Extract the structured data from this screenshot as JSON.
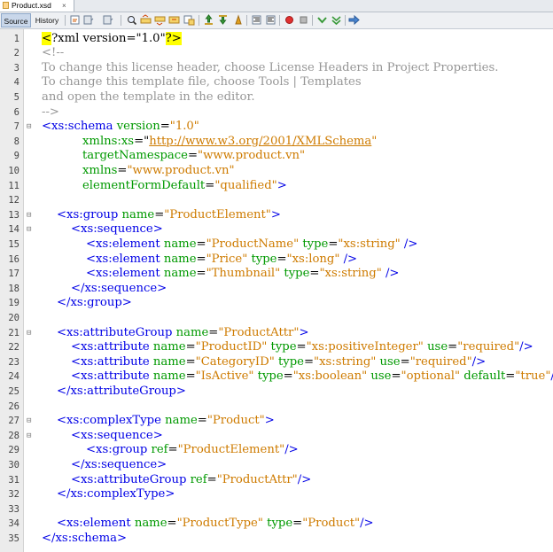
{
  "file_tab": {
    "name": "Product.xsd",
    "close": "×"
  },
  "toolbar": {
    "source_label": "Source",
    "history_label": "History",
    "icons": [
      "last-edit-icon",
      "back-icon",
      "forward-icon",
      "find-icon",
      "find-prev-icon",
      "find-next-icon",
      "toggle-highlight-icon",
      "toggle-rect-select-icon",
      "prev-bookmark-icon",
      "next-bookmark-icon",
      "toggle-bookmark-icon",
      "shift-left-icon",
      "shift-right-icon",
      "start-macro-icon",
      "stop-macro-icon",
      "check-xml-icon",
      "validate-xml-icon",
      "xsl-transform-icon"
    ]
  },
  "lines": [
    {
      "n": "1",
      "fold": "",
      "indent": 0,
      "segs": [
        [
          "pi",
          "<"
        ],
        [
          "pi",
          "?xml "
        ],
        [
          "pi",
          "version=\"1.0\""
        ],
        [
          "pi",
          "?>"
        ]
      ]
    },
    {
      "n": "2",
      "fold": "",
      "indent": 0,
      "segs": [
        [
          "cmt",
          "<!--"
        ]
      ]
    },
    {
      "n": "3",
      "fold": "",
      "indent": 0,
      "segs": [
        [
          "cmt",
          "To change this license header, choose License Headers in Project Properties."
        ]
      ]
    },
    {
      "n": "4",
      "fold": "",
      "indent": 0,
      "segs": [
        [
          "cmt",
          "To change this template file, choose Tools | Templates"
        ]
      ]
    },
    {
      "n": "5",
      "fold": "",
      "indent": 0,
      "segs": [
        [
          "cmt",
          "and open the template in the editor."
        ]
      ]
    },
    {
      "n": "6",
      "fold": "",
      "indent": 0,
      "segs": [
        [
          "cmt",
          "-->"
        ]
      ]
    },
    {
      "n": "7",
      "fold": "-",
      "indent": 0,
      "segs": [
        [
          "tag",
          "<xs:schema "
        ],
        [
          "attr",
          "version"
        ],
        [
          "txt",
          "="
        ],
        [
          "val",
          "\"1.0\""
        ]
      ]
    },
    {
      "n": "8",
      "fold": "",
      "indent": 1,
      "segs": [
        [
          "attr",
          "xmlns:xs"
        ],
        [
          "txt",
          "=\""
        ],
        [
          "link",
          "http://www.w3.org/2001/XMLSchema"
        ],
        [
          "val",
          "\""
        ]
      ]
    },
    {
      "n": "9",
      "fold": "",
      "indent": 1,
      "segs": [
        [
          "attr",
          "targetNamespace"
        ],
        [
          "txt",
          "="
        ],
        [
          "val",
          "\"www.product.vn\""
        ]
      ]
    },
    {
      "n": "10",
      "fold": "",
      "indent": 1,
      "segs": [
        [
          "attr",
          "xmlns"
        ],
        [
          "txt",
          "="
        ],
        [
          "val",
          "\"www.product.vn\""
        ]
      ]
    },
    {
      "n": "11",
      "fold": "",
      "indent": 1,
      "segs": [
        [
          "attr",
          "elementFormDefault"
        ],
        [
          "txt",
          "="
        ],
        [
          "val",
          "\"qualified\""
        ],
        [
          "tag",
          ">"
        ]
      ]
    },
    {
      "n": "12",
      "fold": "",
      "indent": 0,
      "segs": []
    },
    {
      "n": "13",
      "fold": "-",
      "indent": 2,
      "segs": [
        [
          "tag",
          "<xs:group "
        ],
        [
          "attr",
          "name"
        ],
        [
          "txt",
          "="
        ],
        [
          "val",
          "\"ProductElement\""
        ],
        [
          "tag",
          ">"
        ]
      ]
    },
    {
      "n": "14",
      "fold": "-",
      "indent": 3,
      "segs": [
        [
          "tag",
          "<xs:sequence>"
        ]
      ]
    },
    {
      "n": "15",
      "fold": "",
      "indent": 4,
      "segs": [
        [
          "tag",
          "<xs:element "
        ],
        [
          "attr",
          "name"
        ],
        [
          "txt",
          "="
        ],
        [
          "val",
          "\"ProductName\""
        ],
        [
          "txt",
          " "
        ],
        [
          "attr",
          "type"
        ],
        [
          "txt",
          "="
        ],
        [
          "val",
          "\"xs:string\""
        ],
        [
          "tag",
          " />"
        ]
      ]
    },
    {
      "n": "16",
      "fold": "",
      "indent": 4,
      "segs": [
        [
          "tag",
          "<xs:element "
        ],
        [
          "attr",
          "name"
        ],
        [
          "txt",
          "="
        ],
        [
          "val",
          "\"Price\""
        ],
        [
          "txt",
          " "
        ],
        [
          "attr",
          "type"
        ],
        [
          "txt",
          "="
        ],
        [
          "val",
          "\"xs:long\""
        ],
        [
          "tag",
          " />"
        ]
      ]
    },
    {
      "n": "17",
      "fold": "",
      "indent": 4,
      "segs": [
        [
          "tag",
          "<xs:element "
        ],
        [
          "attr",
          "name"
        ],
        [
          "txt",
          "="
        ],
        [
          "val",
          "\"Thumbnail\""
        ],
        [
          "txt",
          " "
        ],
        [
          "attr",
          "type"
        ],
        [
          "txt",
          "="
        ],
        [
          "val",
          "\"xs:string\""
        ],
        [
          "tag",
          " />"
        ]
      ]
    },
    {
      "n": "18",
      "fold": "",
      "indent": 3,
      "segs": [
        [
          "tag",
          "</xs:sequence>"
        ]
      ]
    },
    {
      "n": "19",
      "fold": "",
      "indent": 2,
      "segs": [
        [
          "tag",
          "</xs:group>"
        ]
      ]
    },
    {
      "n": "20",
      "fold": "",
      "indent": 0,
      "segs": []
    },
    {
      "n": "21",
      "fold": "-",
      "indent": 2,
      "segs": [
        [
          "tag",
          "<xs:attributeGroup "
        ],
        [
          "attr",
          "name"
        ],
        [
          "txt",
          "="
        ],
        [
          "val",
          "\"ProductAttr\""
        ],
        [
          "tag",
          ">"
        ]
      ]
    },
    {
      "n": "22",
      "fold": "",
      "indent": 3,
      "segs": [
        [
          "tag",
          "<xs:attribute "
        ],
        [
          "attr",
          "name"
        ],
        [
          "txt",
          "="
        ],
        [
          "val",
          "\"ProductID\""
        ],
        [
          "txt",
          " "
        ],
        [
          "attr",
          "type"
        ],
        [
          "txt",
          "="
        ],
        [
          "val",
          "\"xs:positiveInteger\""
        ],
        [
          "txt",
          " "
        ],
        [
          "attr",
          "use"
        ],
        [
          "txt",
          "="
        ],
        [
          "val",
          "\"required\""
        ],
        [
          "tag",
          "/>"
        ]
      ]
    },
    {
      "n": "23",
      "fold": "",
      "indent": 3,
      "segs": [
        [
          "tag",
          "<xs:attribute "
        ],
        [
          "attr",
          "name"
        ],
        [
          "txt",
          "="
        ],
        [
          "val",
          "\"CategoryID\""
        ],
        [
          "txt",
          " "
        ],
        [
          "attr",
          "type"
        ],
        [
          "txt",
          "="
        ],
        [
          "val",
          "\"xs:string\""
        ],
        [
          "txt",
          " "
        ],
        [
          "attr",
          "use"
        ],
        [
          "txt",
          "="
        ],
        [
          "val",
          "\"required\""
        ],
        [
          "tag",
          "/>"
        ]
      ]
    },
    {
      "n": "24",
      "fold": "",
      "indent": 3,
      "segs": [
        [
          "tag",
          "<xs:attribute "
        ],
        [
          "attr",
          "name"
        ],
        [
          "txt",
          "="
        ],
        [
          "val",
          "\"IsActive\""
        ],
        [
          "txt",
          " "
        ],
        [
          "attr",
          "type"
        ],
        [
          "txt",
          "="
        ],
        [
          "val",
          "\"xs:boolean\""
        ],
        [
          "txt",
          " "
        ],
        [
          "attr",
          "use"
        ],
        [
          "txt",
          "="
        ],
        [
          "val",
          "\"optional\""
        ],
        [
          "txt",
          " "
        ],
        [
          "attr",
          "default"
        ],
        [
          "txt",
          "="
        ],
        [
          "val",
          "\"true\""
        ],
        [
          "tag",
          "/>"
        ]
      ]
    },
    {
      "n": "25",
      "fold": "",
      "indent": 2,
      "segs": [
        [
          "tag",
          "</xs:attributeGroup>"
        ]
      ]
    },
    {
      "n": "26",
      "fold": "",
      "indent": 0,
      "segs": []
    },
    {
      "n": "27",
      "fold": "-",
      "indent": 2,
      "segs": [
        [
          "tag",
          "<xs:complexType "
        ],
        [
          "attr",
          "name"
        ],
        [
          "txt",
          "="
        ],
        [
          "val",
          "\"Product\""
        ],
        [
          "tag",
          ">"
        ]
      ]
    },
    {
      "n": "28",
      "fold": "-",
      "indent": 3,
      "segs": [
        [
          "tag",
          "<xs:sequence>"
        ]
      ]
    },
    {
      "n": "29",
      "fold": "",
      "indent": 4,
      "segs": [
        [
          "tag",
          "<xs:group "
        ],
        [
          "attr",
          "ref"
        ],
        [
          "txt",
          "="
        ],
        [
          "val",
          "\"ProductElement\""
        ],
        [
          "tag",
          "/>"
        ]
      ]
    },
    {
      "n": "30",
      "fold": "",
      "indent": 3,
      "segs": [
        [
          "tag",
          "</xs:sequence>"
        ]
      ]
    },
    {
      "n": "31",
      "fold": "",
      "indent": 3,
      "segs": [
        [
          "tag",
          "<xs:attributeGroup "
        ],
        [
          "attr",
          "ref"
        ],
        [
          "txt",
          "="
        ],
        [
          "val",
          "\"ProductAttr\""
        ],
        [
          "tag",
          "/>"
        ]
      ]
    },
    {
      "n": "32",
      "fold": "",
      "indent": 2,
      "segs": [
        [
          "tag",
          "</xs:complexType>"
        ]
      ]
    },
    {
      "n": "33",
      "fold": "",
      "indent": 0,
      "segs": []
    },
    {
      "n": "34",
      "fold": "",
      "indent": 2,
      "segs": [
        [
          "tag",
          "<xs:element "
        ],
        [
          "attr",
          "name"
        ],
        [
          "txt",
          "="
        ],
        [
          "val",
          "\"ProductType\""
        ],
        [
          "txt",
          " "
        ],
        [
          "attr",
          "type"
        ],
        [
          "txt",
          "="
        ],
        [
          "val",
          "\"Product\""
        ],
        [
          "tag",
          "/>"
        ]
      ]
    },
    {
      "n": "35",
      "fold": "",
      "indent": 0,
      "segs": [
        [
          "tag",
          "</xs:schema>"
        ]
      ]
    }
  ],
  "colors": {
    "tag": "#0000e6",
    "attr": "#009900",
    "value": "#ce7b00",
    "comment": "#969696",
    "match_highlight": "#ffff00"
  }
}
